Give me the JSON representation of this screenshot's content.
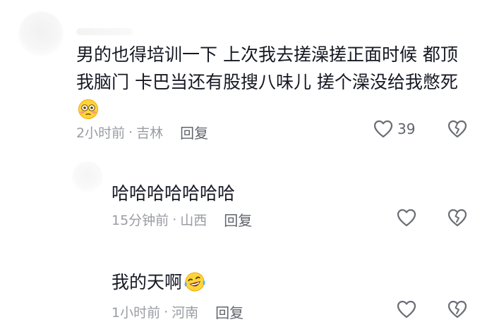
{
  "comments": [
    {
      "text": "男的也得培训一下 上次我去搓澡搓正面时候 都顶我脑门 卡巴当还有股搜八味儿 搓个澡没给我憋死",
      "emoji": "flushed-face",
      "time": "2小时前",
      "location": "吉林",
      "reply_label": "回复",
      "like_count": "39"
    },
    {
      "text": "哈哈哈哈哈哈哈",
      "emoji": "",
      "time": "15分钟前",
      "location": "山西",
      "reply_label": "回复",
      "like_count": ""
    },
    {
      "text": "我的天啊",
      "emoji": "laughing-crying-face",
      "time": "1小时前",
      "location": "河南",
      "reply_label": "回复",
      "like_count": ""
    }
  ],
  "meta_separator": "·",
  "colors": {
    "text": "#161823",
    "meta": "#9a9ca3",
    "reply": "#62646d",
    "icon": "#6b6d75"
  }
}
